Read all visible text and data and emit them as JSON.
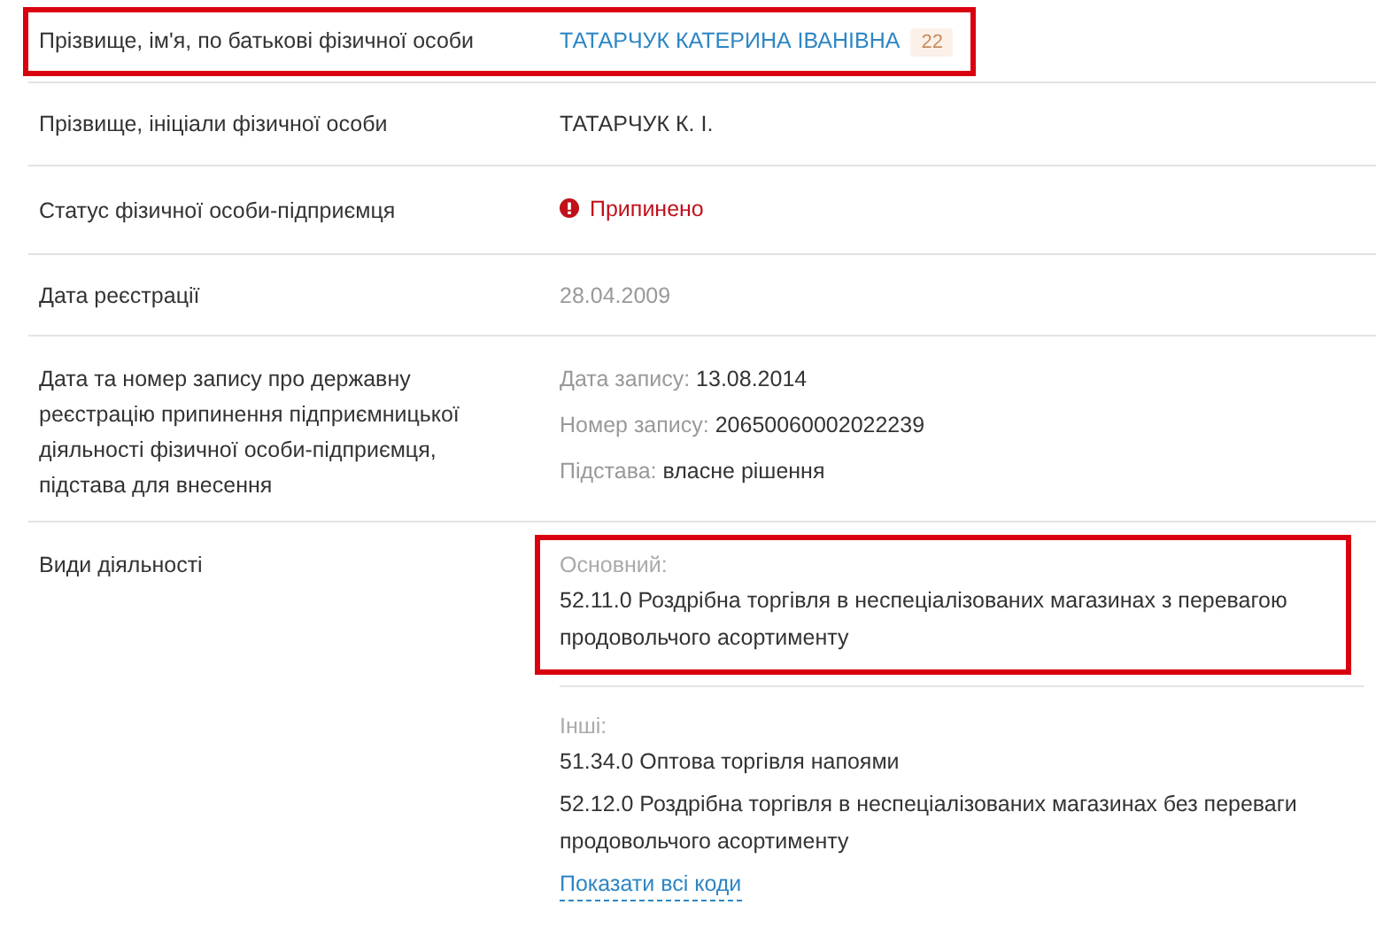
{
  "rows": [
    {
      "kind": "name",
      "label": "Прізвище, ім'я, по батькові фізичної особи",
      "value": "ТАТАРЧУК КАТЕРИНА ІВАНІВНА",
      "badge": "22",
      "highlighted": true
    },
    {
      "kind": "text",
      "label": "Прізвище, ініціали фізичної особи",
      "value": "ТАТАРЧУК К. І.",
      "highlighted": false
    },
    {
      "kind": "status",
      "label": "Статус фізичної особи-підприємця",
      "value": "Припинено",
      "highlighted": false
    },
    {
      "kind": "muted",
      "label": "Дата реєстрації",
      "value": "28.04.2009",
      "highlighted": false
    },
    {
      "kind": "record",
      "label": "Дата та номер запису про державну реєстрацію припинення підприємницької діяльності фізичної особи-підприємця, підстава для внесення",
      "fields": [
        {
          "caption": "Дата запису:",
          "value": "13.08.2014"
        },
        {
          "caption": "Номер запису:",
          "value": "20650060002022239"
        },
        {
          "caption": "Підстава:",
          "value": "власне рішення"
        }
      ],
      "highlighted": false
    },
    {
      "kind": "activities",
      "label": "Види діяльності",
      "groups": [
        {
          "caption": "Основний:",
          "highlighted": true,
          "items": [
            "52.11.0 Роздрібна торгівля в неспеціалізованих магазинах з перевагою продовольчого асортименту"
          ]
        },
        {
          "caption": "Інші:",
          "highlighted": false,
          "items": [
            "51.34.0 Оптова торгівля напоями",
            "52.12.0 Роздрібна торгівля в неспеціалізованих магазинах без переваги продовольчого асортименту"
          ]
        }
      ],
      "link": "Показати всі коди",
      "highlighted": false
    }
  ]
}
